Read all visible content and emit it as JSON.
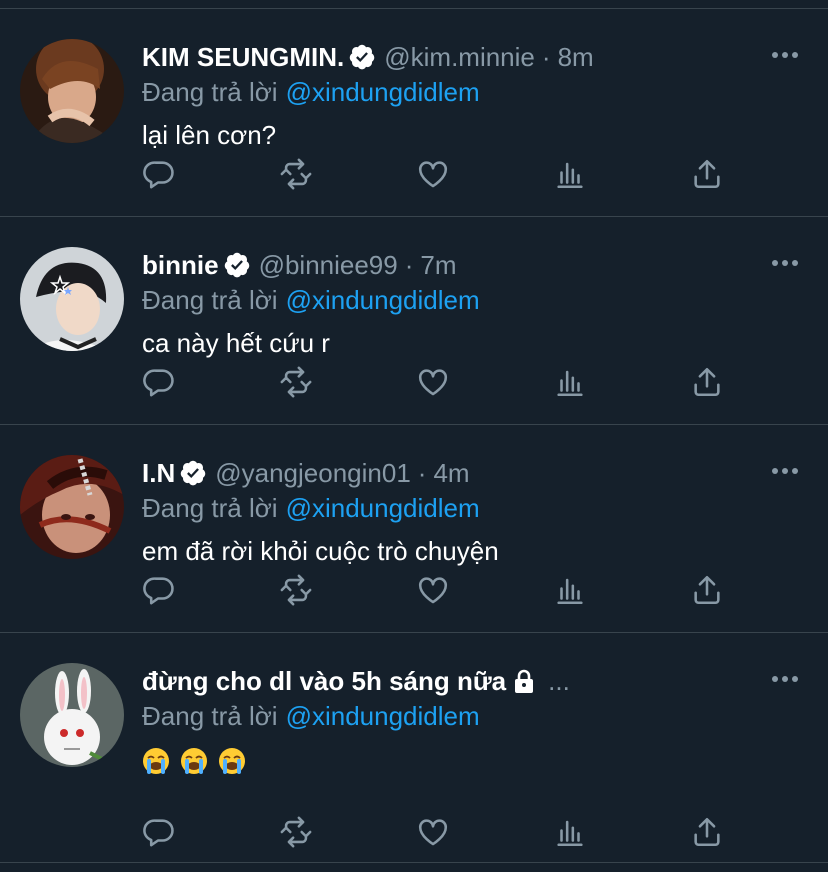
{
  "theme": {
    "background": "#15202b",
    "divider": "#38444d",
    "text": "#ffffff",
    "muted": "#8899a6",
    "accent": "#1da1f2"
  },
  "reply_prefix": "Đang trả lời",
  "tweets": [
    {
      "display_name": "KIM SEUNGMIN.",
      "verified": true,
      "handle": "@kim.minnie",
      "separator": "·",
      "time": "8m",
      "reply_to": "@xindungdidlem",
      "text": "lại lên cơn?"
    },
    {
      "display_name": "binnie",
      "verified": true,
      "handle": "@binniee99",
      "separator": "·",
      "time": "7m",
      "reply_to": "@xindungdidlem",
      "text": "ca này hết cứu r"
    },
    {
      "display_name": "I.N",
      "verified": true,
      "handle": "@yangjeongin01",
      "separator": "·",
      "time": "4m",
      "reply_to": "@xindungdidlem",
      "text": "em đã rời khỏi cuộc trò chuyện"
    },
    {
      "display_name": "đừng cho dl vào 5h sáng nữa",
      "verified": false,
      "locked": true,
      "handle_truncated": "...",
      "reply_to": "@xindungdidlem",
      "emojis": [
        "loudly-crying-face",
        "loudly-crying-face",
        "loudly-crying-face"
      ]
    }
  ],
  "icons": {
    "reply": "reply-icon",
    "retweet": "retweet-icon",
    "like": "heart-icon",
    "analytics": "analytics-icon",
    "share": "share-icon",
    "more": "more-icon",
    "verified": "verified-badge-icon",
    "lock": "lock-icon"
  }
}
